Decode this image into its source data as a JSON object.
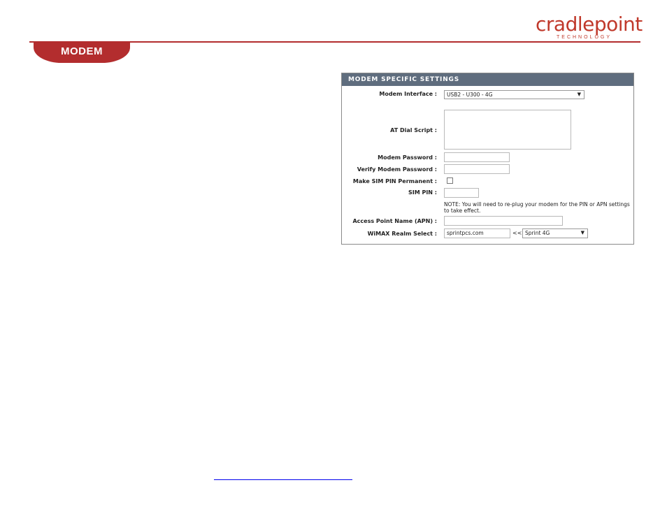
{
  "brand": {
    "name": "cradlepoint",
    "tagline": "TECHNOLOGY",
    "color": "#b32d2e"
  },
  "section_tab": {
    "label": "MODEM"
  },
  "panel": {
    "title": "MODEM SPECIFIC SETTINGS",
    "modem_interface": {
      "label": "Modem Interface :",
      "value": "USB2 - U300 - 4G"
    },
    "at_dial_script": {
      "label": "AT Dial Script :",
      "value": ""
    },
    "modem_password": {
      "label": "Modem Password :",
      "value": ""
    },
    "verify_modem_password": {
      "label": "Verify Modem Password :",
      "value": ""
    },
    "sim_pin_permanent": {
      "label": "Make SIM PIN Permanent :",
      "checked": false
    },
    "sim_pin": {
      "label": "SIM PIN :",
      "value": ""
    },
    "note": "NOTE: You will need to re-plug your modem for the PIN or APN settings to take effect.",
    "apn": {
      "label": "Access Point Name (APN) :",
      "value": ""
    },
    "wimax_realm": {
      "label": "WiMAX Realm Select :",
      "value": "sprintpcs.com",
      "separator": "<<",
      "preset": "Sprint 4G"
    }
  },
  "footer": {
    "link_text": ""
  }
}
